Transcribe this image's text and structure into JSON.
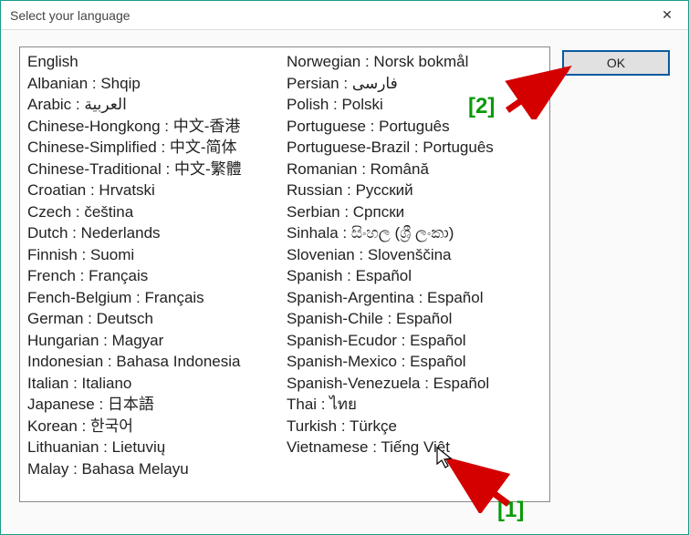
{
  "window": {
    "title": "Select your language",
    "close_glyph": "✕"
  },
  "ok_button_label": "OK",
  "languages_col1": [
    "English",
    "Albanian : Shqip",
    "Arabic : العربية",
    "Chinese-Hongkong : 中文-香港",
    "Chinese-Simplified : 中文-简体",
    "Chinese-Traditional : 中文-繁體",
    "Croatian : Hrvatski",
    "Czech : čeština",
    "Dutch : Nederlands",
    "Finnish : Suomi",
    "French : Français",
    "Fench-Belgium : Français",
    "German : Deutsch",
    "Hungarian : Magyar",
    "Indonesian : Bahasa Indonesia",
    "Italian : Italiano",
    "Japanese : 日本語",
    "Korean : 한국어",
    "Lithuanian : Lietuvių",
    "Malay : Bahasa Melayu"
  ],
  "languages_col2": [
    "Norwegian : Norsk bokmål",
    "Persian : فارسی",
    "Polish : Polski",
    "Portuguese : Português",
    "Portuguese-Brazil : Português",
    "Romanian : Română",
    "Russian : Русский",
    "Serbian : Српски",
    "Sinhala : සිංහල (ශ්‍රී ලංකා)",
    "Slovenian : Slovenščina",
    "Spanish : Español",
    "Spanish-Argentina : Español",
    "Spanish-Chile : Español",
    "Spanish-Ecudor : Español",
    "Spanish-Mexico : Español",
    "Spanish-Venezuela : Español",
    "Thai : ไทย",
    "Turkish : Türkçe",
    "Vietnamese : Tiếng Việt"
  ],
  "annotations": {
    "label1": "[1]",
    "label2": "[2]"
  }
}
